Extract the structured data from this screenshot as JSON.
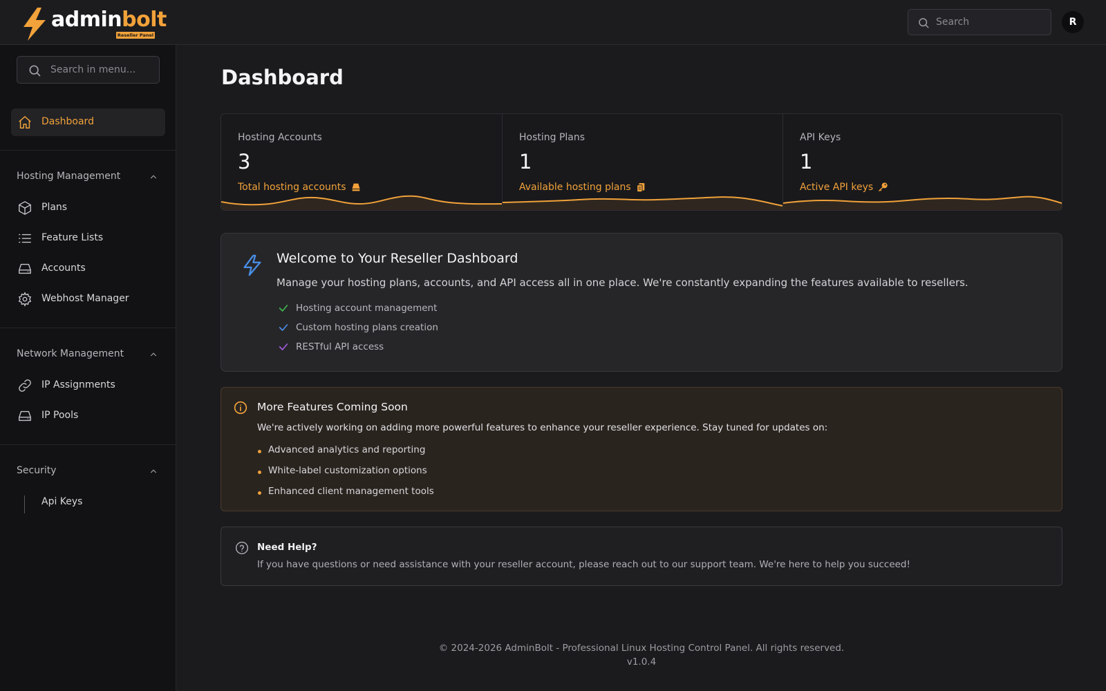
{
  "brand": {
    "name_part1": "admin",
    "name_part2": "bolt",
    "badge": "Reseller Panel",
    "accent": "#f2a23a"
  },
  "header": {
    "search_placeholder": "Search",
    "avatar_initial": "R"
  },
  "sidebar": {
    "search_placeholder": "Search in menu...",
    "dashboard": {
      "label": "Dashboard",
      "icon": "home-icon"
    },
    "groups": [
      {
        "label": "Hosting Management",
        "items": [
          {
            "label": "Plans",
            "icon": "cube-icon"
          },
          {
            "label": "Feature Lists",
            "icon": "list-icon"
          },
          {
            "label": "Accounts",
            "icon": "server-icon"
          },
          {
            "label": "Webhost Manager",
            "icon": "gear-icon"
          }
        ]
      },
      {
        "label": "Network Management",
        "items": [
          {
            "label": "IP Assignments",
            "icon": "link-icon"
          },
          {
            "label": "IP Pools",
            "icon": "server-icon"
          }
        ]
      },
      {
        "label": "Security",
        "items": [
          {
            "label": "Api Keys"
          }
        ]
      }
    ]
  },
  "main": {
    "title": "Dashboard",
    "stats": [
      {
        "title": "Hosting Accounts",
        "value": "3",
        "desc": "Total hosting accounts",
        "icon": "server-icon"
      },
      {
        "title": "Hosting Plans",
        "value": "1",
        "desc": "Available hosting plans",
        "icon": "clipboard-icon"
      },
      {
        "title": "API Keys",
        "value": "1",
        "desc": "Active API keys",
        "icon": "key-icon"
      }
    ],
    "welcome": {
      "title": "Welcome to Your Reseller Dashboard",
      "text": "Manage your hosting plans, accounts, and API access all in one place. We're constantly expanding the features available to resellers.",
      "features": [
        {
          "label": "Hosting account management",
          "color": "#3fb950"
        },
        {
          "label": "Custom hosting plans creation",
          "color": "#4a8fe7"
        },
        {
          "label": "RESTful API access",
          "color": "#a45de0"
        }
      ]
    },
    "coming_soon": {
      "title": "More Features Coming Soon",
      "text": "We're actively working on adding more powerful features to enhance your reseller experience. Stay tuned for updates on:",
      "items": [
        "Advanced analytics and reporting",
        "White-label customization options",
        "Enhanced client management tools"
      ]
    },
    "help": {
      "title": "Need Help?",
      "text": "If you have questions or need assistance with your reseller account, please reach out to our support team. We're here to help you succeed!"
    }
  },
  "footer": {
    "copyright": "© 2024-2026 AdminBolt - Professional Linux Hosting Control Panel. All rights reserved.",
    "version": "v1.0.4"
  }
}
